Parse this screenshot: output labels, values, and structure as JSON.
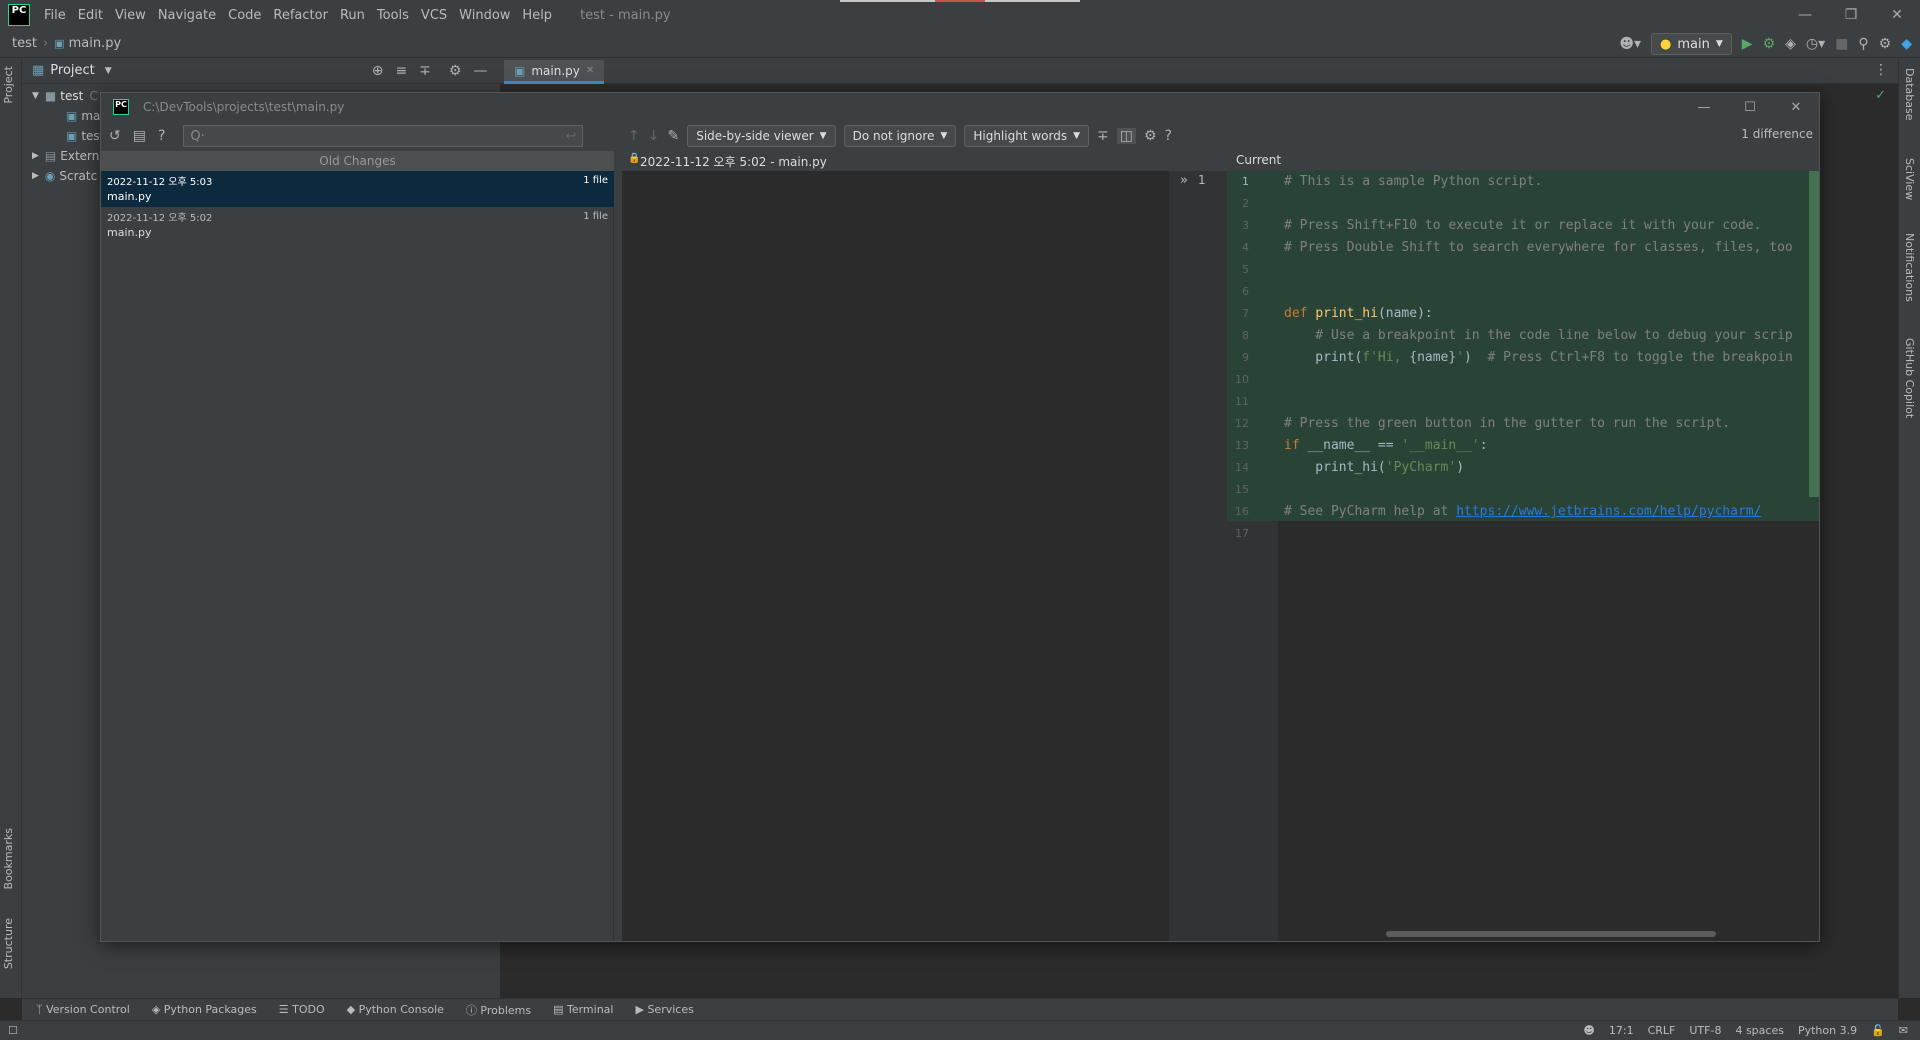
{
  "menubar": {
    "logo": "PC",
    "items": [
      "File",
      "Edit",
      "View",
      "Navigate",
      "Code",
      "Refactor",
      "Run",
      "Tools",
      "VCS",
      "Window",
      "Help"
    ],
    "title": "test - main.py"
  },
  "navbar": {
    "project": "test",
    "file": "main.py",
    "run_config": "main"
  },
  "project_panel": {
    "title": "Project",
    "tree": [
      "test",
      "ma",
      "test",
      "Extern",
      "Scratc"
    ],
    "tree_suffix": "C"
  },
  "editor_tabs": [
    {
      "label": "main.py"
    }
  ],
  "left_stripe": {
    "project": "Project",
    "bookmarks": "Bookmarks",
    "structure": "Structure"
  },
  "right_stripe": {
    "database": "Database",
    "sciview": "SciView",
    "notifications": "Notifications",
    "copilot": "GitHub Copilot"
  },
  "dialog": {
    "logo": "PC",
    "path": "C:\\DevTools\\projects\\test\\main.py",
    "search_placeholder": "Q·",
    "list_header": "Old Changes",
    "revisions": [
      {
        "date": "2022-11-12 오후 5:03",
        "file": "main.py",
        "count": "1 file"
      },
      {
        "date": "2022-11-12 오후 5:02",
        "file": "main.py",
        "count": "1 file"
      }
    ],
    "viewer": "Side-by-side viewer",
    "ignore": "Do not ignore",
    "highlight": "Highlight words",
    "difference_count": "1 difference",
    "left_title": "2022-11-12 오후 5:02 - main.py",
    "right_title": "Current",
    "gutter_marker": "1"
  },
  "code_lines": [
    {
      "n": "1",
      "parts": [
        [
          "cmt",
          "# This is a sample Python script."
        ]
      ]
    },
    {
      "n": "2",
      "parts": []
    },
    {
      "n": "3",
      "parts": [
        [
          "cmt",
          "# Press Shift+F10 to execute it or replace it with your code."
        ]
      ]
    },
    {
      "n": "4",
      "parts": [
        [
          "cmt",
          "# Press Double Shift to search everywhere for classes, files, too"
        ]
      ]
    },
    {
      "n": "5",
      "parts": []
    },
    {
      "n": "6",
      "parts": []
    },
    {
      "n": "7",
      "parts": [
        [
          "kw",
          "def "
        ],
        [
          "fn",
          "print_hi"
        ],
        [
          "",
          "(name):"
        ]
      ]
    },
    {
      "n": "8",
      "parts": [
        [
          "cmt",
          "    # Use a breakpoint in the code line below to debug your scrip"
        ]
      ]
    },
    {
      "n": "9",
      "parts": [
        [
          "",
          "    print("
        ],
        [
          "str",
          "f'Hi, "
        ],
        [
          "",
          "{name}"
        ],
        [
          "str",
          "'"
        ],
        [
          "",
          ")  "
        ],
        [
          "cmt",
          "# Press Ctrl+F8 to toggle the breakpoin"
        ]
      ]
    },
    {
      "n": "10",
      "parts": []
    },
    {
      "n": "11",
      "parts": []
    },
    {
      "n": "12",
      "parts": [
        [
          "cmt",
          "# Press the green button in the gutter to run the script."
        ]
      ]
    },
    {
      "n": "13",
      "parts": [
        [
          "kw",
          "if "
        ],
        [
          "",
          "__name__ == "
        ],
        [
          "str",
          "'__main__'"
        ],
        [
          "",
          ":"
        ]
      ]
    },
    {
      "n": "14",
      "parts": [
        [
          "",
          "    print_hi("
        ],
        [
          "str",
          "'PyCharm'"
        ],
        [
          "",
          ")"
        ]
      ]
    },
    {
      "n": "15",
      "parts": []
    },
    {
      "n": "16",
      "parts": [
        [
          "cmt",
          "# See PyCharm help at "
        ],
        [
          "lnk",
          "https://www.jetbrains.com/help/pycharm/"
        ]
      ]
    },
    {
      "n": "17",
      "parts": []
    }
  ],
  "bottom_tools": [
    "Version Control",
    "Python Packages",
    "TODO",
    "Python Console",
    "Problems",
    "Terminal",
    "Services"
  ],
  "status": {
    "position": "17:1",
    "line_sep": "CRLF",
    "encoding": "UTF-8",
    "indent": "4 spaces",
    "interpreter": "Python 3.9"
  }
}
